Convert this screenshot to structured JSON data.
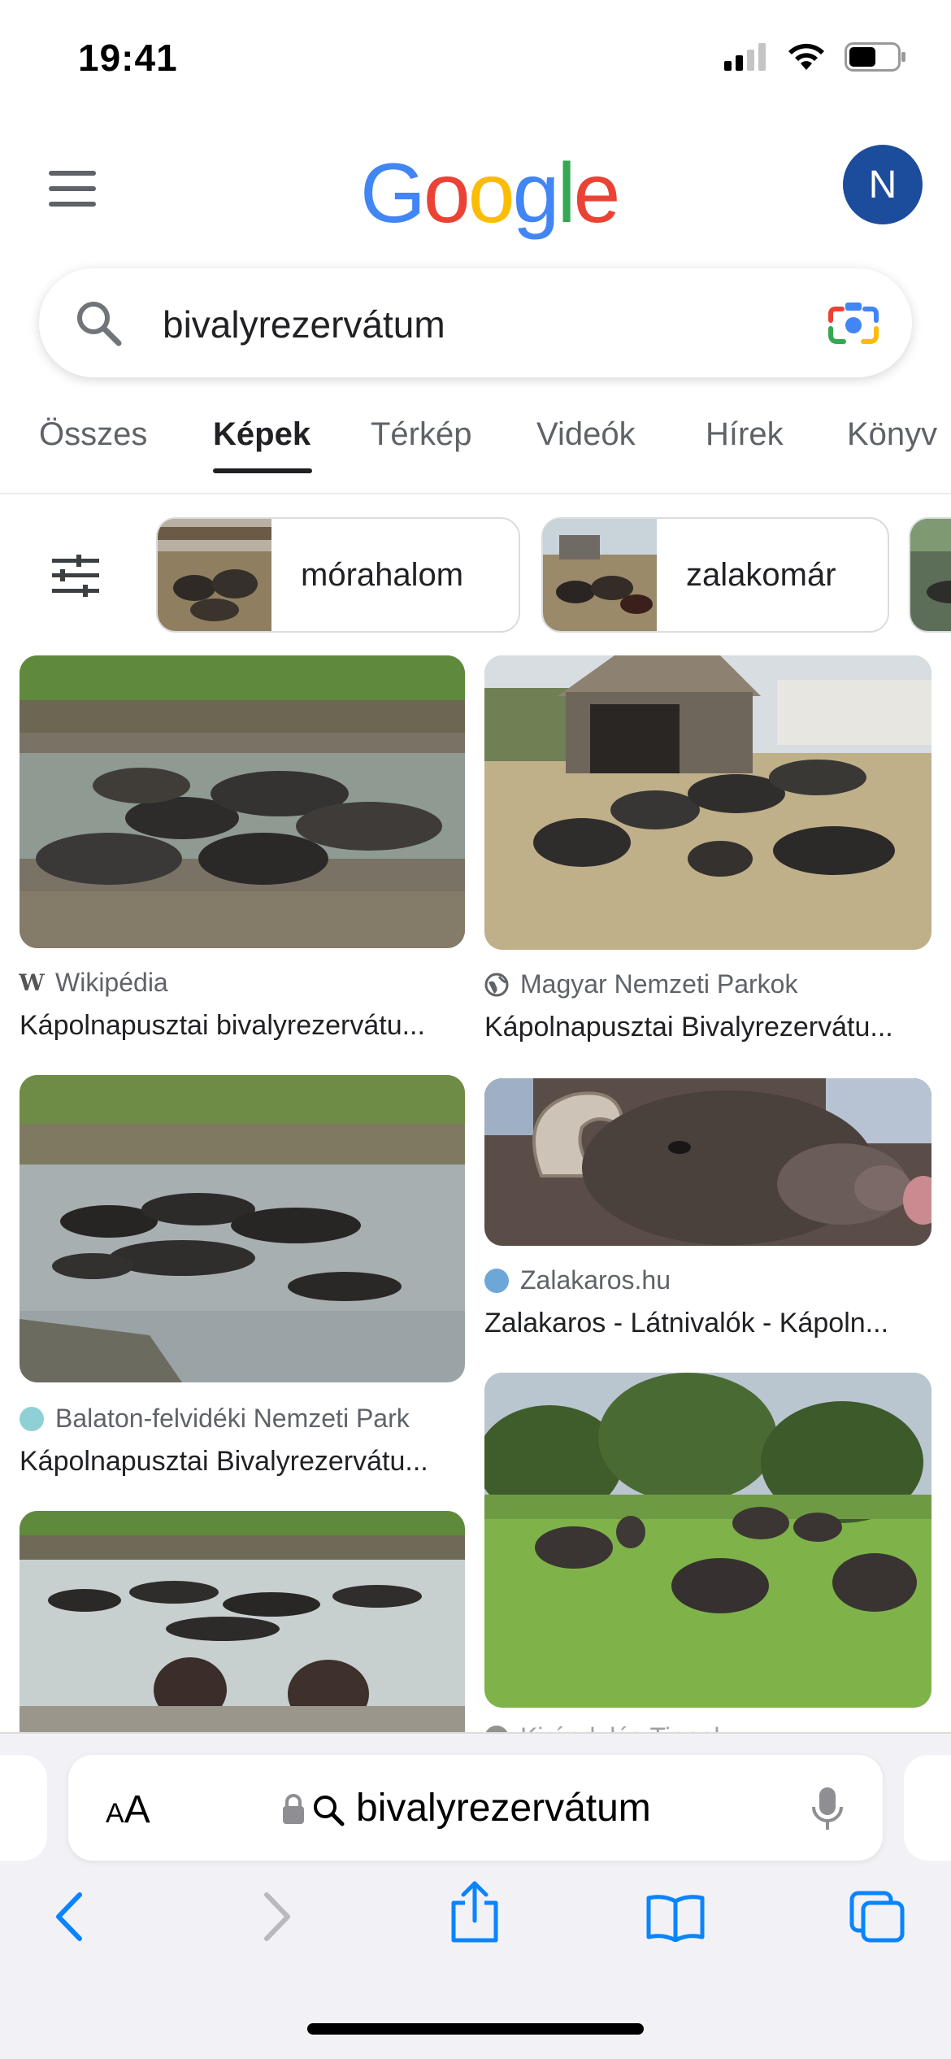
{
  "status": {
    "time": "19:41"
  },
  "header": {
    "logo": "Google",
    "avatar_letter": "N"
  },
  "search": {
    "query": "bivalyrezervátum"
  },
  "tabs": [
    {
      "label": "Összes"
    },
    {
      "label": "Képek"
    },
    {
      "label": "Térkép"
    },
    {
      "label": "Videók"
    },
    {
      "label": "Hírek"
    },
    {
      "label": "Könyv"
    }
  ],
  "chips": [
    {
      "label": "mórahalom"
    },
    {
      "label": "zalakomár"
    }
  ],
  "results": [
    {
      "source": "Wikipédia",
      "title": "Kápolnapusztai bivalyrezervátu..."
    },
    {
      "source": "Magyar Nemzeti Parkok",
      "title": "Kápolnapusztai Bivalyrezervátu..."
    },
    {
      "source": "Balaton-felvidéki Nemzeti Park",
      "title": "Kápolnapusztai Bivalyrezervátu..."
    },
    {
      "source": "Zalakaros.hu",
      "title": "Zalakaros - Látnivalók - Kápoln..."
    },
    {
      "source": "Kirándulás Tippek"
    }
  ],
  "safari": {
    "url": "bivalyrezervátum",
    "text_size_label_small": "A",
    "text_size_label_large": "A"
  },
  "colors": {
    "google_blue": "#4285F4",
    "google_red": "#EA4335",
    "google_yellow": "#FBBC05",
    "google_green": "#34A853",
    "avatar": "#1C4C9C",
    "safari_blue": "#0A84FF"
  }
}
